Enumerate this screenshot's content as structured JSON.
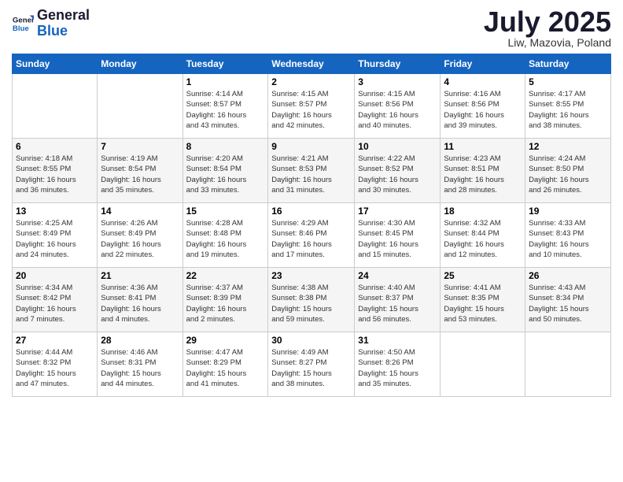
{
  "logo": {
    "line1": "General",
    "line2": "Blue"
  },
  "title": "July 2025",
  "location": "Liw, Mazovia, Poland",
  "days_of_week": [
    "Sunday",
    "Monday",
    "Tuesday",
    "Wednesday",
    "Thursday",
    "Friday",
    "Saturday"
  ],
  "weeks": [
    [
      {
        "day": "",
        "info": ""
      },
      {
        "day": "",
        "info": ""
      },
      {
        "day": "1",
        "info": "Sunrise: 4:14 AM\nSunset: 8:57 PM\nDaylight: 16 hours\nand 43 minutes."
      },
      {
        "day": "2",
        "info": "Sunrise: 4:15 AM\nSunset: 8:57 PM\nDaylight: 16 hours\nand 42 minutes."
      },
      {
        "day": "3",
        "info": "Sunrise: 4:15 AM\nSunset: 8:56 PM\nDaylight: 16 hours\nand 40 minutes."
      },
      {
        "day": "4",
        "info": "Sunrise: 4:16 AM\nSunset: 8:56 PM\nDaylight: 16 hours\nand 39 minutes."
      },
      {
        "day": "5",
        "info": "Sunrise: 4:17 AM\nSunset: 8:55 PM\nDaylight: 16 hours\nand 38 minutes."
      }
    ],
    [
      {
        "day": "6",
        "info": "Sunrise: 4:18 AM\nSunset: 8:55 PM\nDaylight: 16 hours\nand 36 minutes."
      },
      {
        "day": "7",
        "info": "Sunrise: 4:19 AM\nSunset: 8:54 PM\nDaylight: 16 hours\nand 35 minutes."
      },
      {
        "day": "8",
        "info": "Sunrise: 4:20 AM\nSunset: 8:54 PM\nDaylight: 16 hours\nand 33 minutes."
      },
      {
        "day": "9",
        "info": "Sunrise: 4:21 AM\nSunset: 8:53 PM\nDaylight: 16 hours\nand 31 minutes."
      },
      {
        "day": "10",
        "info": "Sunrise: 4:22 AM\nSunset: 8:52 PM\nDaylight: 16 hours\nand 30 minutes."
      },
      {
        "day": "11",
        "info": "Sunrise: 4:23 AM\nSunset: 8:51 PM\nDaylight: 16 hours\nand 28 minutes."
      },
      {
        "day": "12",
        "info": "Sunrise: 4:24 AM\nSunset: 8:50 PM\nDaylight: 16 hours\nand 26 minutes."
      }
    ],
    [
      {
        "day": "13",
        "info": "Sunrise: 4:25 AM\nSunset: 8:49 PM\nDaylight: 16 hours\nand 24 minutes."
      },
      {
        "day": "14",
        "info": "Sunrise: 4:26 AM\nSunset: 8:49 PM\nDaylight: 16 hours\nand 22 minutes."
      },
      {
        "day": "15",
        "info": "Sunrise: 4:28 AM\nSunset: 8:48 PM\nDaylight: 16 hours\nand 19 minutes."
      },
      {
        "day": "16",
        "info": "Sunrise: 4:29 AM\nSunset: 8:46 PM\nDaylight: 16 hours\nand 17 minutes."
      },
      {
        "day": "17",
        "info": "Sunrise: 4:30 AM\nSunset: 8:45 PM\nDaylight: 16 hours\nand 15 minutes."
      },
      {
        "day": "18",
        "info": "Sunrise: 4:32 AM\nSunset: 8:44 PM\nDaylight: 16 hours\nand 12 minutes."
      },
      {
        "day": "19",
        "info": "Sunrise: 4:33 AM\nSunset: 8:43 PM\nDaylight: 16 hours\nand 10 minutes."
      }
    ],
    [
      {
        "day": "20",
        "info": "Sunrise: 4:34 AM\nSunset: 8:42 PM\nDaylight: 16 hours\nand 7 minutes."
      },
      {
        "day": "21",
        "info": "Sunrise: 4:36 AM\nSunset: 8:41 PM\nDaylight: 16 hours\nand 4 minutes."
      },
      {
        "day": "22",
        "info": "Sunrise: 4:37 AM\nSunset: 8:39 PM\nDaylight: 16 hours\nand 2 minutes."
      },
      {
        "day": "23",
        "info": "Sunrise: 4:38 AM\nSunset: 8:38 PM\nDaylight: 15 hours\nand 59 minutes."
      },
      {
        "day": "24",
        "info": "Sunrise: 4:40 AM\nSunset: 8:37 PM\nDaylight: 15 hours\nand 56 minutes."
      },
      {
        "day": "25",
        "info": "Sunrise: 4:41 AM\nSunset: 8:35 PM\nDaylight: 15 hours\nand 53 minutes."
      },
      {
        "day": "26",
        "info": "Sunrise: 4:43 AM\nSunset: 8:34 PM\nDaylight: 15 hours\nand 50 minutes."
      }
    ],
    [
      {
        "day": "27",
        "info": "Sunrise: 4:44 AM\nSunset: 8:32 PM\nDaylight: 15 hours\nand 47 minutes."
      },
      {
        "day": "28",
        "info": "Sunrise: 4:46 AM\nSunset: 8:31 PM\nDaylight: 15 hours\nand 44 minutes."
      },
      {
        "day": "29",
        "info": "Sunrise: 4:47 AM\nSunset: 8:29 PM\nDaylight: 15 hours\nand 41 minutes."
      },
      {
        "day": "30",
        "info": "Sunrise: 4:49 AM\nSunset: 8:27 PM\nDaylight: 15 hours\nand 38 minutes."
      },
      {
        "day": "31",
        "info": "Sunrise: 4:50 AM\nSunset: 8:26 PM\nDaylight: 15 hours\nand 35 minutes."
      },
      {
        "day": "",
        "info": ""
      },
      {
        "day": "",
        "info": ""
      }
    ]
  ]
}
